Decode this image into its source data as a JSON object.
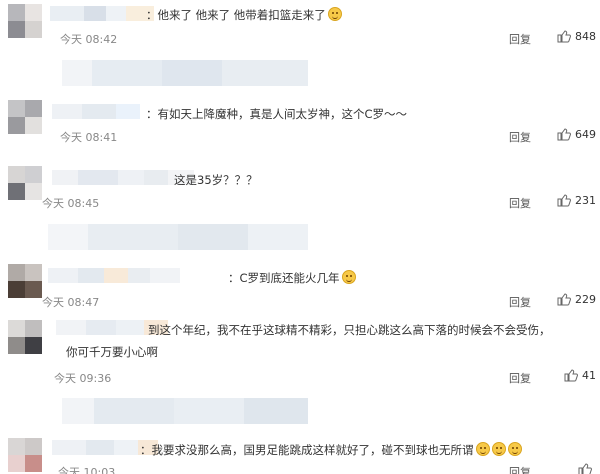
{
  "comments": [
    {
      "text": "：他来了 他来了 他带着扣篮走来了",
      "time": "今天 08:42",
      "reply": "回复",
      "likes": "848",
      "emoji": 1
    },
    {
      "text": "：有如天上降魔种，真是人间太岁神，这个C罗～～",
      "time": "今天 08:41",
      "reply": "回复",
      "likes": "649",
      "emoji": 0
    },
    {
      "text": "这是35岁？？？",
      "time": "今天 08:45",
      "reply": "回复",
      "likes": "231",
      "emoji": 0
    },
    {
      "text": "：C罗到底还能火几年",
      "time": "今天 08:47",
      "reply": "回复",
      "likes": "229",
      "emoji": 1
    },
    {
      "text": "到这个年纪，我不在乎这球精不精彩，只担心跳这么高下落的时候会不会受伤，",
      "text2": "你可千万要小心啊",
      "time": "今天 09:36",
      "reply": "回复",
      "likes": "41",
      "emoji": 0
    },
    {
      "text": "：我要求没那么高，国男足能跳成这样就好了，碰不到球也无所谓",
      "time": "今天 10:03",
      "reply": "回复",
      "likes": "",
      "emoji": 3
    }
  ],
  "icons": {
    "like": "thumbs-up-icon",
    "emoji": "smile-emoji-icon"
  }
}
